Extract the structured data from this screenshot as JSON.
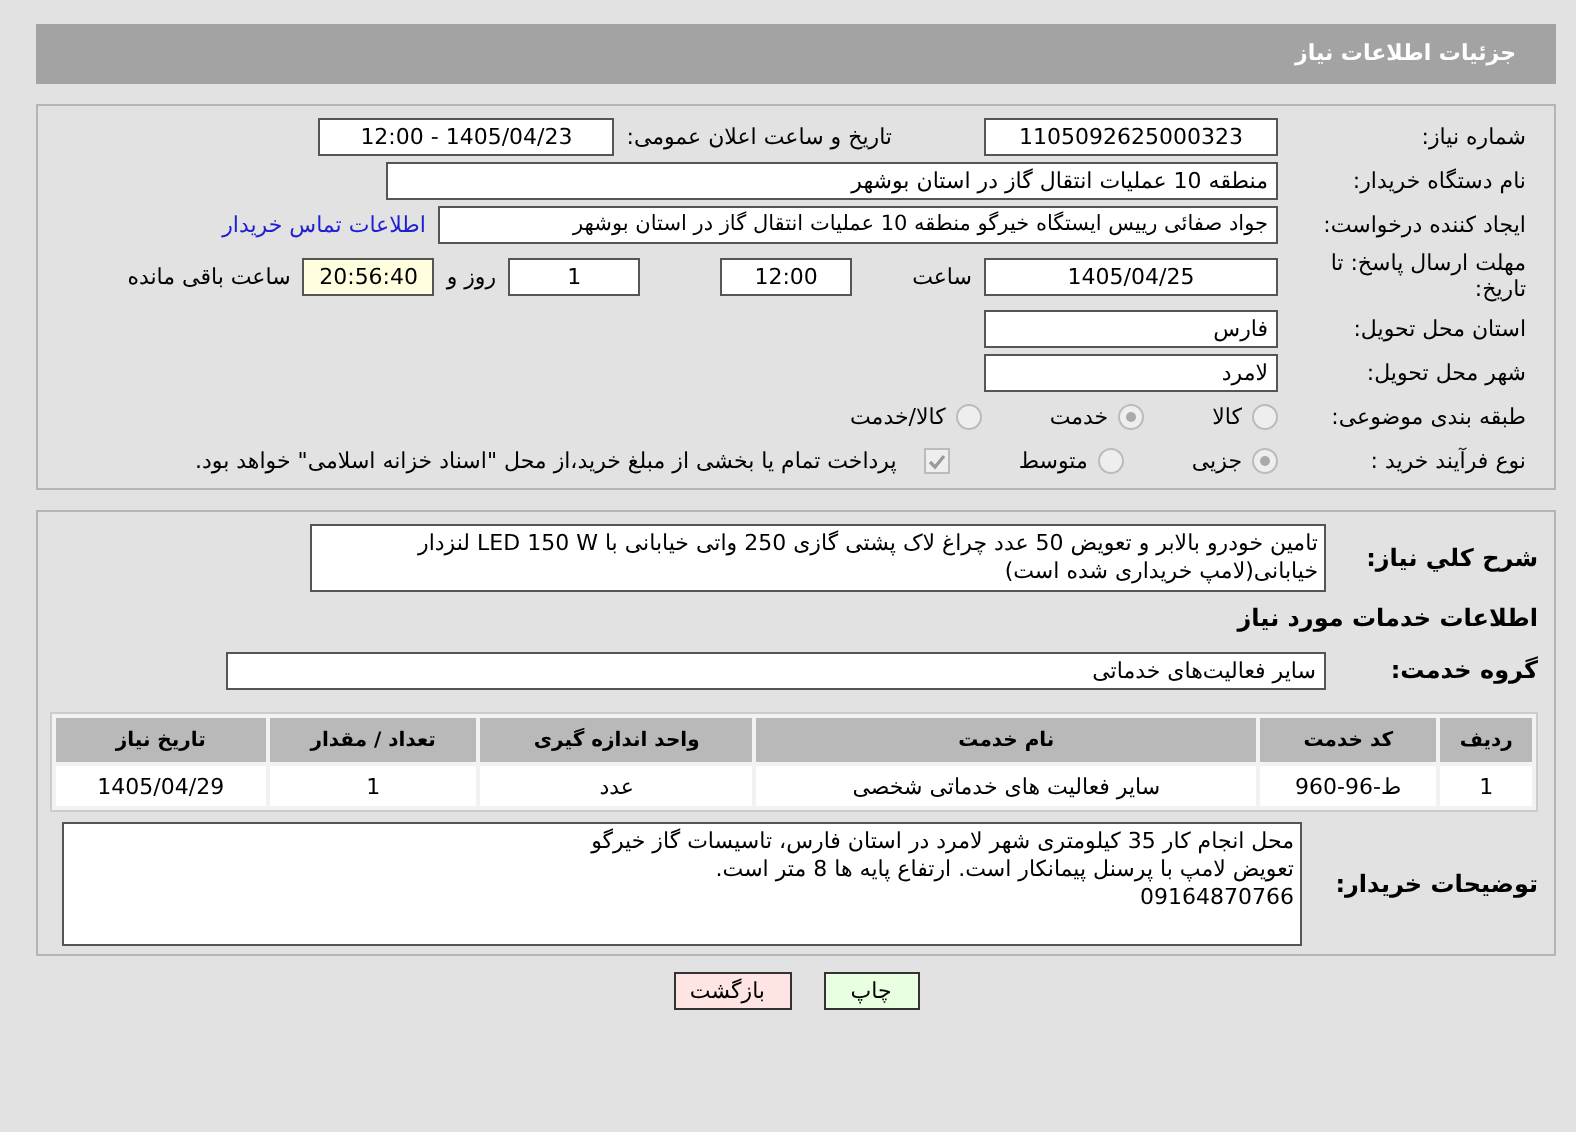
{
  "header": {
    "title": "جزئیات اطلاعات نیاز"
  },
  "fields": {
    "need_number": {
      "label": "شماره نیاز:",
      "value": "1105092625000323"
    },
    "announce": {
      "label": "تاریخ و ساعت اعلان عمومی:",
      "value": "1405/04/23 - 12:00"
    },
    "buyer": {
      "label": "نام دستگاه خریدار:",
      "value": "منطقه 10 عملیات انتقال گاز در استان بوشهر"
    },
    "creator": {
      "label": "ایجاد کننده درخواست:",
      "value": "جواد صفائی رییس ایستگاه خیرگو منطقه 10 عملیات انتقال گاز در استان بوشهر",
      "link": "اطلاعات تماس خریدار"
    },
    "deadline": {
      "label": "مهلت ارسال پاسخ: تا تاریخ:",
      "date": "1405/04/25",
      "time_label": "ساعت",
      "time": "12:00",
      "days": "1",
      "days_label": "روز و",
      "remaining": "20:56:40",
      "remaining_label": "ساعت باقی مانده"
    },
    "province": {
      "label": "استان محل تحویل:",
      "value": "فارس"
    },
    "city": {
      "label": "شهر محل تحویل:",
      "value": "لامرد"
    }
  },
  "category": {
    "label": "طبقه بندی موضوعی:",
    "options": [
      {
        "label": "کالا",
        "selected": false
      },
      {
        "label": "خدمت",
        "selected": true
      },
      {
        "label": "کالا/خدمت",
        "selected": false
      }
    ]
  },
  "process": {
    "label": "نوع فرآیند خرید :",
    "options": [
      {
        "label": "جزیی",
        "selected": true
      },
      {
        "label": "متوسط",
        "selected": false
      }
    ],
    "payment": {
      "label": "پرداخت تمام یا بخشی از مبلغ خرید،از محل \"اسناد خزانه اسلامی\" خواهد بود.",
      "checked": true,
      "disabled": true
    }
  },
  "description": {
    "label": "شرح كلي نياز:",
    "value": "تامین خودرو بالابر و تعویض 50 عدد چراغ لاک پشتی گازی 250 واتی خیابانی  با LED 150 W  لنزدار خیابانی(لامپ خریداری شده است)"
  },
  "services_heading": "اطلاعات خدمات مورد نیاز",
  "service_group": {
    "label": "گروه خدمت:",
    "value": "سایر فعالیت‌های خدماتی"
  },
  "table": {
    "columns": [
      "ردیف",
      "کد خدمت",
      "نام خدمت",
      "واحد اندازه گیری",
      "تعداد / مقدار",
      "تاریخ نیاز"
    ],
    "rows": [
      [
        "1",
        "ط-96-960",
        "سایر فعالیت های خدماتی شخصی",
        "عدد",
        "1",
        "1405/04/29"
      ]
    ]
  },
  "buyer_notes": {
    "label": "توضیحات خریدار:",
    "lines": [
      "محل انجام کار 35 کیلومتری شهر لامرد در استان فارس، تاسیسات گاز خیرگو",
      "تعویض لامپ با پرسنل پیمانکار است. ارتفاع پایه ها 8 متر است.",
      "09164870766"
    ]
  },
  "buttons": [
    {
      "label": "چاپ",
      "kind": "print"
    },
    {
      "label": "بازگشت",
      "kind": "back"
    }
  ]
}
